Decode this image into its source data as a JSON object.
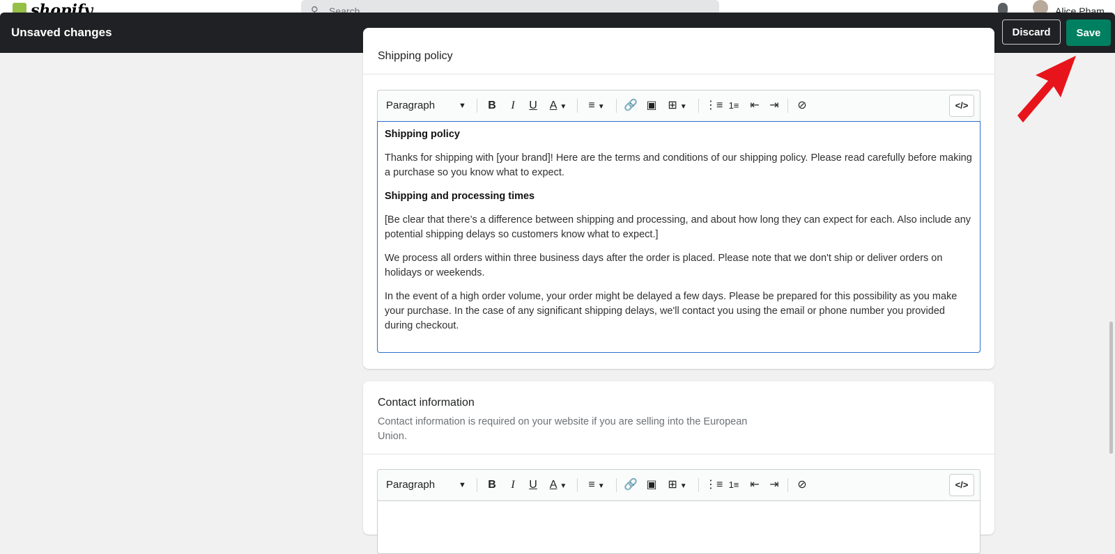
{
  "topbar": {
    "brand": "shopify",
    "search_placeholder": "Search",
    "user_name": "Alice Pham"
  },
  "save_bar": {
    "message": "Unsaved changes",
    "discard_label": "Discard",
    "save_label": "Save",
    "save_color": "#008060"
  },
  "shipping_card": {
    "title": "Shipping policy",
    "toolbar": {
      "paragraph_label": "Paragraph",
      "bold": "B",
      "italic": "I",
      "underline": "U",
      "text_color": "A",
      "code_label": "</>"
    },
    "content": {
      "heading1": "Shipping policy",
      "p1": "Thanks for shipping with [your brand]! Here are the terms and conditions of our shipping policy. Please read carefully before making a purchase so you know what to expect.",
      "heading2": "Shipping and processing times",
      "p2": "[Be clear that there’s a difference between shipping and processing, and about how long they can expect for each. Also include any potential shipping delays so customers know what to expect.]",
      "p3": "We process all orders within three business days after the order is placed. Please note that we don't ship or deliver orders on holidays or weekends.",
      "p4": "In the event of a high order volume, your order might be delayed a few days. Please be prepared for this possibility as you make your purchase. In the case of any significant shipping delays, we'll contact you using the email or phone number you provided during checkout."
    }
  },
  "contact_card": {
    "title": "Contact information",
    "description": "Contact information is required on your website if you are selling into the European Union.",
    "toolbar": {
      "paragraph_label": "Paragraph",
      "bold": "B",
      "italic": "I",
      "underline": "U",
      "text_color": "A",
      "code_label": "</>"
    }
  },
  "annotation": {
    "arrow_color": "#e8141c"
  }
}
